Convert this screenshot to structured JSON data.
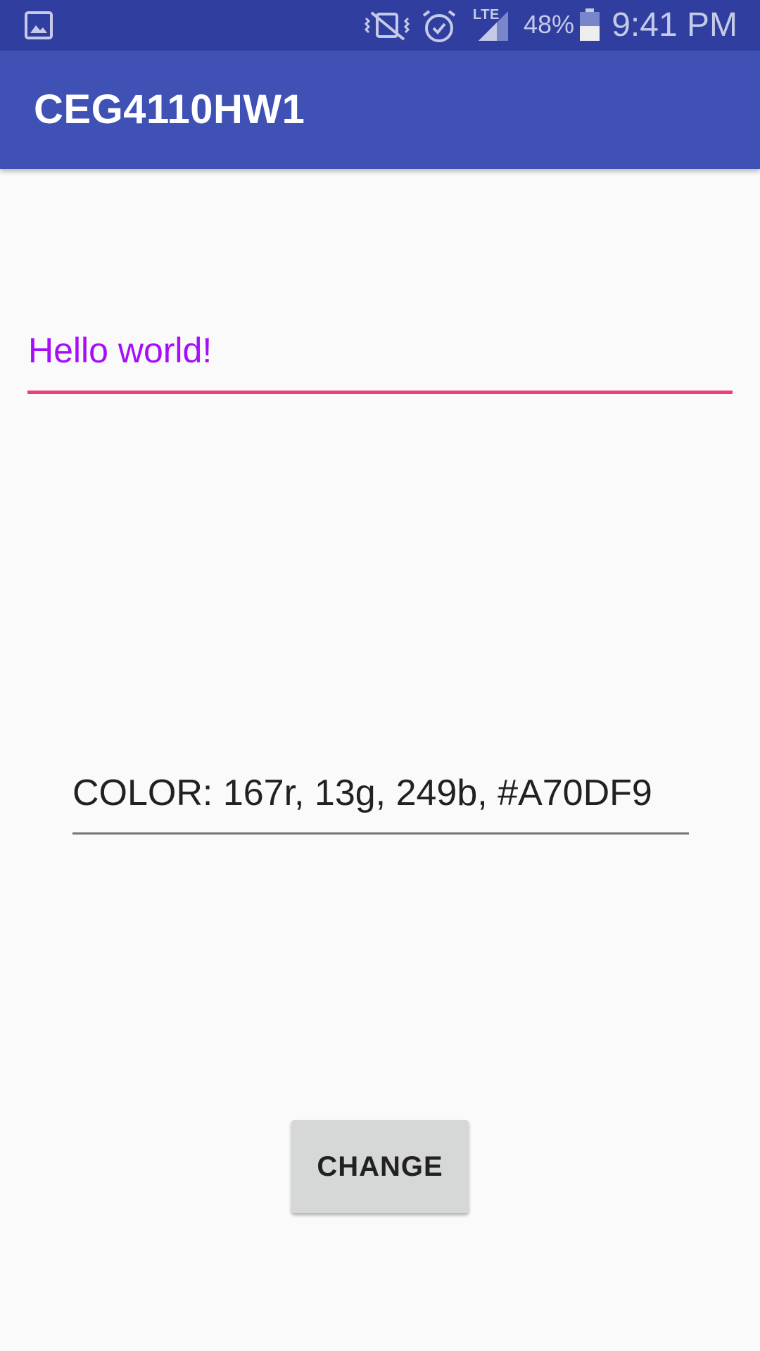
{
  "status_bar": {
    "icons": [
      "gallery-icon",
      "mute-vibrate-icon",
      "alarm-icon",
      "signal-icon",
      "battery-icon"
    ],
    "network_label": "LTE",
    "battery_percent": "48%",
    "time": "9:41 PM"
  },
  "app_bar": {
    "title": "CEG4110HW1"
  },
  "main": {
    "hello_text": "Hello world!",
    "hello_text_color": "#A70DF9",
    "color_readout": "COLOR: 167r, 13g, 249b, #A70DF9",
    "change_button_label": "CHANGE"
  },
  "colors": {
    "status_bar": "#303F9F",
    "app_bar": "#3F51B5",
    "accent": "#EC407A",
    "background": "#FAFAFA"
  }
}
